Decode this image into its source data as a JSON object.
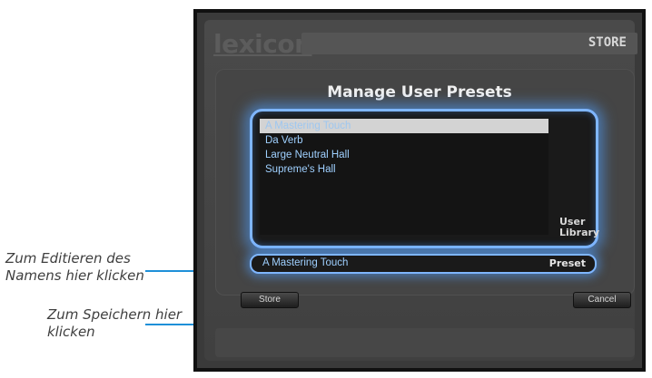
{
  "callouts": {
    "edit_name": "Zum Editieren des Namens hier klicken",
    "store": "Zum Speichern hier klicken"
  },
  "header": {
    "logo": "lexicon",
    "mode": "STORE"
  },
  "dialog": {
    "title": "Manage User Presets",
    "library_label": "User Library",
    "library_items": [
      "A Mastering Touch",
      "Da Verb",
      "Large Neutral Hall",
      "Supreme's Hall"
    ],
    "selected_index": 0,
    "preset_name": "A Mastering Touch",
    "preset_label": "Preset",
    "store_label": "Store",
    "cancel_label": "Cancel"
  },
  "colors": {
    "callout_line": "#1e90d8",
    "glow": "#7fb6ff",
    "list_text": "#9fd0ff"
  }
}
